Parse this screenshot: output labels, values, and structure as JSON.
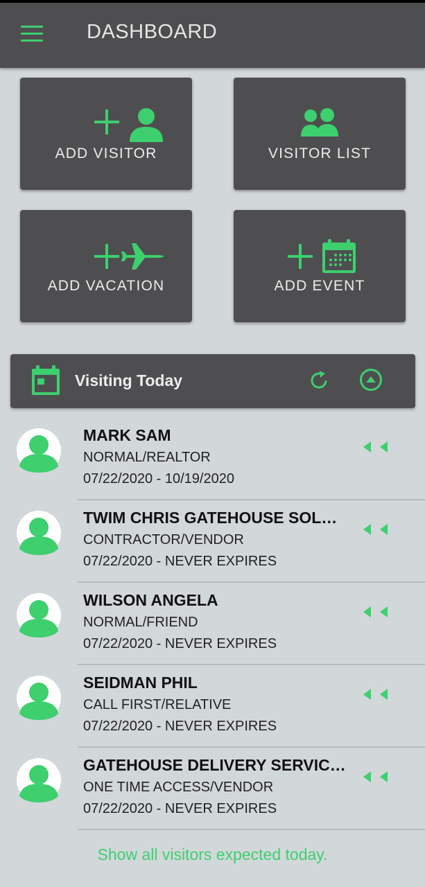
{
  "appbar": {
    "title": "DASHBOARD",
    "menu_icon": "hamburger-menu-icon"
  },
  "tiles": [
    {
      "label": "ADD VISITOR",
      "icon": "add-person-icon"
    },
    {
      "label": "VISITOR LIST",
      "icon": "people-icon"
    },
    {
      "label": "ADD VACATION",
      "icon": "add-airplane-icon"
    },
    {
      "label": "ADD EVENT",
      "icon": "add-calendar-icon"
    }
  ],
  "visiting_today": {
    "title": "Visiting Today",
    "icons": [
      "calendar-icon",
      "refresh-icon",
      "collapse-up-icon"
    ]
  },
  "visitors": [
    {
      "name": "MARK SAM",
      "type": "NORMAL/REALTOR",
      "dates": "07/22/2020 - 10/19/2020"
    },
    {
      "name": "TWIM CHRIS GATEHOUSE SOL…",
      "type": "CONTRACTOR/VENDOR",
      "dates": "07/22/2020 - NEVER EXPIRES"
    },
    {
      "name": "WILSON ANGELA",
      "type": "NORMAL/FRIEND",
      "dates": "07/22/2020 - NEVER EXPIRES"
    },
    {
      "name": "SEIDMAN PHIL",
      "type": "CALL FIRST/RELATIVE",
      "dates": "07/22/2020 - NEVER EXPIRES"
    },
    {
      "name": "GATEHOUSE DELIVERY SERVIC…",
      "type": "ONE TIME ACCESS/VENDOR",
      "dates": "07/22/2020 - NEVER EXPIRES"
    }
  ],
  "footer": {
    "link": "Show all visitors expected today."
  },
  "colors": {
    "accent": "#3ecf6e",
    "bar": "#4e4e50",
    "background": "#d2d7da"
  }
}
